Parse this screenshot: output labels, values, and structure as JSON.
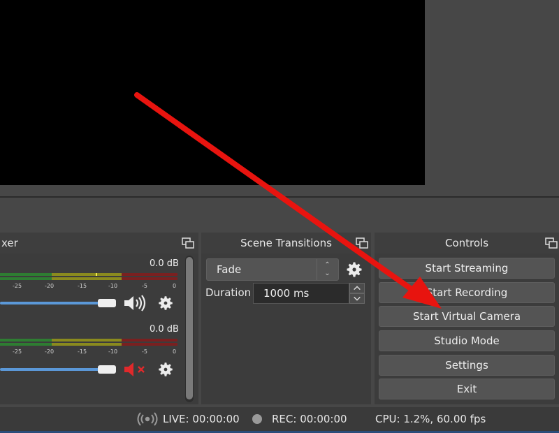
{
  "docks": {
    "mixer_title": "xer",
    "transitions_title": "Scene Transitions",
    "controls_title": "Controls"
  },
  "mixer": {
    "channels": [
      {
        "db": "0.0 dB",
        "muted": false
      },
      {
        "db": "0.0 dB",
        "muted": true
      }
    ],
    "ticks": [
      "-25",
      "-20",
      "-15",
      "-10",
      "-5",
      "0"
    ]
  },
  "transitions": {
    "selected": "Fade",
    "duration_label": "Duration",
    "duration_value": "1000 ms"
  },
  "controls": {
    "buttons": [
      "Start Streaming",
      "Start Recording",
      "Start Virtual Camera",
      "Studio Mode",
      "Settings",
      "Exit"
    ]
  },
  "status": {
    "live": "LIVE: 00:00:00",
    "rec": "REC: 00:00:00",
    "cpu": "CPU: 1.2%, 60.00 fps"
  },
  "colors": {
    "annotation_arrow": "#e8140f",
    "meter_green": "#2e7d32",
    "meter_yellow": "#8a8a1e",
    "meter_red": "#7a2020",
    "volume_blue": "#5b98d8",
    "muted_red": "#e0292b"
  }
}
